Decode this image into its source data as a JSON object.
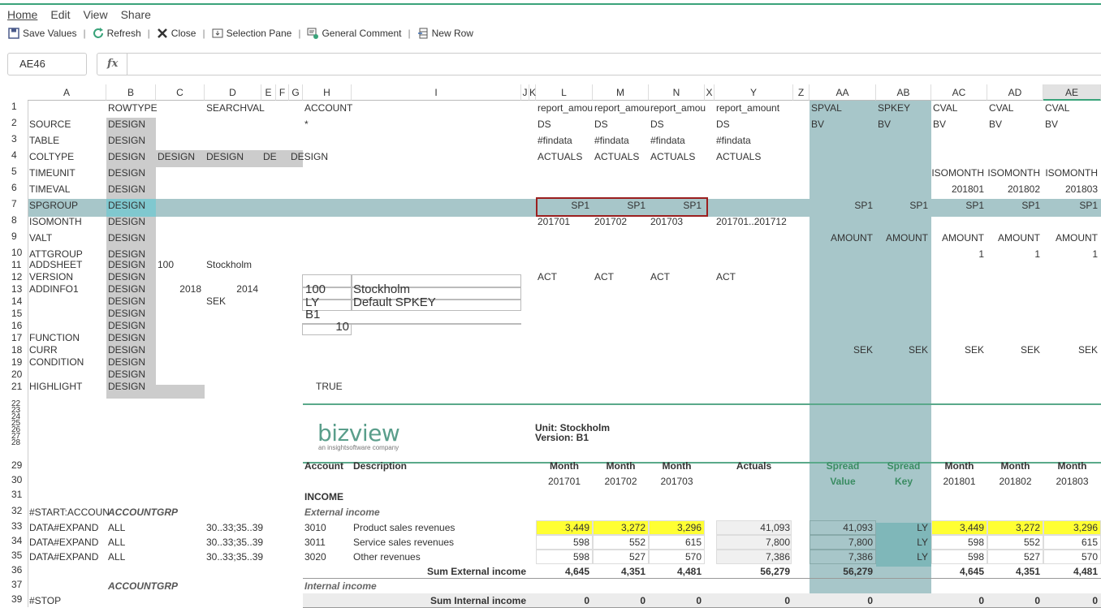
{
  "menu": [
    "Home",
    "Edit",
    "View",
    "Share"
  ],
  "toolbar": {
    "save": "Save Values",
    "refresh": "Refresh",
    "close": "Close",
    "selection_pane": "Selection Pane",
    "general_comment": "General Comment",
    "new_row": "New Row",
    "sep": "|"
  },
  "namebox": "AE46",
  "fx_label": "fx",
  "columns": [
    "A",
    "B",
    "C",
    "D",
    "E",
    "F",
    "G",
    "H",
    "I",
    "J",
    "K",
    "L",
    "M",
    "N",
    "X",
    "Y",
    "Z",
    "AA",
    "AB",
    "AC",
    "AD",
    "AE"
  ],
  "rows": [
    "1",
    "2",
    "3",
    "4",
    "5",
    "6",
    "7",
    "8",
    "9",
    "10",
    "11",
    "12",
    "13",
    "14",
    "15",
    "16",
    "17",
    "18",
    "19",
    "20",
    "21",
    "22",
    "23",
    "24",
    "25",
    "26",
    "27",
    "28",
    "29",
    "30",
    "31",
    "32",
    "33",
    "34",
    "35",
    "36",
    "37",
    "39"
  ],
  "colA": {
    "2": "SOURCE",
    "3": "TABLE",
    "4": "COLTYPE",
    "5": "TIMEUNIT",
    "6": "TIMEVAL",
    "7": "SPGROUP",
    "8": "ISOMONTH",
    "9": "VALT",
    "10": "ATTGROUP",
    "11": "ADDSHEET",
    "12": "VERSION",
    "13": "ADDINFO1",
    "17": "FUNCTION",
    "18": "CURR",
    "19": "CONDITION",
    "21": "HIGHLIGHT",
    "32": "#START:ACCOUN",
    "33": "DATA#EXPAND",
    "34": "DATA#EXPAND",
    "35": "DATA#EXPAND",
    "39": "#STOP"
  },
  "colB_top": "ROWTYPE",
  "colB_design": "DESIGN",
  "colB_rows": [
    "ACCOUNTGRP",
    "ALL",
    "ALL",
    "ALL",
    "ACCOUNTGRP"
  ],
  "row1": {
    "D": "SEARCHVAL",
    "H": "ACCOUNT",
    "L": "report_amou",
    "M": "report_amou",
    "N": "report_amou",
    "Y": "report_amount",
    "AA": "SPVAL",
    "AB": "SPKEY",
    "AC": "CVAL",
    "AD": "CVAL",
    "AE": "CVAL"
  },
  "row2": {
    "H": "*",
    "L": "DS",
    "M": "DS",
    "N": "DS",
    "Y": "DS",
    "AA": "BV",
    "AB": "BV",
    "AC": "BV",
    "AD": "BV",
    "AE": "BV"
  },
  "row3": {
    "L": "#findata",
    "M": "#findata",
    "N": "#findata",
    "Y": "#findata"
  },
  "row4": {
    "C": "DESIGN",
    "D": "DESIGN",
    "E": "DE",
    "G": "DESIGN",
    "L": "ACTUALS",
    "M": "ACTUALS",
    "N": "ACTUALS",
    "Y": "ACTUALS"
  },
  "row5": {
    "AC": "ISOMONTH",
    "AD": "ISOMONTH",
    "AE": "ISOMONTH"
  },
  "row6": {
    "AC": "201801",
    "AD": "201802",
    "AE": "201803"
  },
  "row7": {
    "L": "SP1",
    "M": "SP1",
    "N": "SP1",
    "AA": "SP1",
    "AB": "SP1",
    "AC": "SP1",
    "AD": "SP1",
    "AE": "SP1"
  },
  "row8": {
    "L": "201701",
    "M": "201702",
    "N": "201703",
    "Y": "201701..201712"
  },
  "row9": {
    "AA": "AMOUNT",
    "AB": "AMOUNT",
    "AC": "AMOUNT",
    "AD": "AMOUNT",
    "AE": "AMOUNT"
  },
  "row10": {
    "AC": "1",
    "AD": "1",
    "AE": "1"
  },
  "row11": {
    "C": "100",
    "D": "Stockholm"
  },
  "row12": {
    "L": "ACT",
    "M": "ACT",
    "N": "ACT",
    "Y": "ACT"
  },
  "row13": {
    "C": "2018",
    "D": "2014"
  },
  "row14": {
    "D": "SEK"
  },
  "row18": {
    "AA": "SEK",
    "AB": "SEK",
    "AC": "SEK",
    "AD": "SEK",
    "AE": "SEK"
  },
  "row21": {
    "H": "TRUE"
  },
  "colD_rows": [
    "30..33;35..39",
    "30..33;35..39",
    "30..33;35..39"
  ],
  "hbox": {
    "r13a": "100",
    "r13b": "Stockholm",
    "r14a": "LY",
    "r14b": "Default SPKEY",
    "r15": "B1",
    "r16": "10"
  },
  "logo": {
    "text": "bizview",
    "tag": "an insightsoftware company"
  },
  "unit": "Unit: Stockholm",
  "version": "Version: B1",
  "report_head": {
    "account": "Account",
    "description": "Description",
    "month": "Month",
    "actuals": "Actuals",
    "spread": "Spread",
    "value": "Value",
    "key": "Key",
    "m1": "201701",
    "m2": "201702",
    "m3": "201703",
    "c1": "201801",
    "c2": "201802",
    "c3": "201803"
  },
  "income": "INCOME",
  "external_income": "External income",
  "internal_income": "Internal income",
  "lines": [
    {
      "acc": "3010",
      "desc": "Product sales revenues",
      "l": "3,449",
      "m": "3,272",
      "n": "3,296",
      "y": "41,093",
      "aa": "41,093",
      "ab": "LY",
      "ac": "3,449",
      "ad": "3,272",
      "ae": "3,296"
    },
    {
      "acc": "3011",
      "desc": "Service sales revenues",
      "l": "598",
      "m": "552",
      "n": "615",
      "y": "7,800",
      "aa": "7,800",
      "ab": "LY",
      "ac": "598",
      "ad": "552",
      "ae": "615"
    },
    {
      "acc": "3020",
      "desc": "Other revenues",
      "l": "598",
      "m": "527",
      "n": "570",
      "y": "7,386",
      "aa": "7,386",
      "ab": "LY",
      "ac": "598",
      "ad": "527",
      "ae": "570"
    }
  ],
  "sum_ext": {
    "label": "Sum External income",
    "l": "4,645",
    "m": "4,351",
    "n": "4,481",
    "y": "56,279",
    "aa": "56,279",
    "ac": "4,645",
    "ad": "4,351",
    "ae": "4,481"
  },
  "sum_int": {
    "label": "Sum Internal income",
    "l": "0",
    "m": "0",
    "n": "0",
    "y": "0",
    "aa": "0",
    "ac": "0",
    "ad": "0",
    "ae": "0"
  },
  "colors": {
    "accent": "#3aa37a",
    "spread_col": "#a7c6c9",
    "design_gray": "#cccccc",
    "input_yellow": "#ffff33",
    "spgroup_band": "#a7c6c9"
  }
}
